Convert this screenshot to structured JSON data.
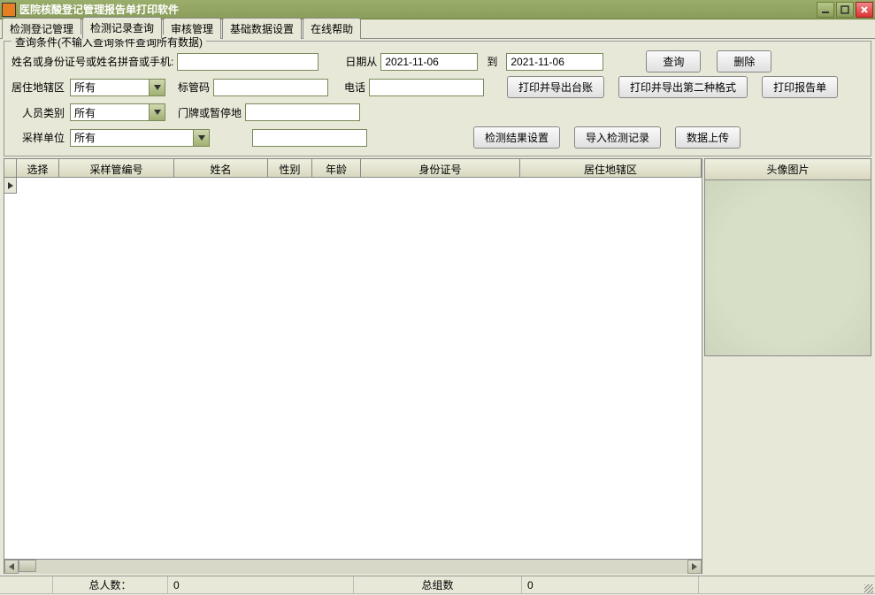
{
  "window": {
    "title": "医院核酸登记管理报告单打印软件"
  },
  "tabs": [
    "检测登记管理",
    "检测记录查询",
    "审核管理",
    "基础数据设置",
    "在线帮助"
  ],
  "activeTabIndex": 1,
  "filter": {
    "legend": "查询条件(不输入查询条件查询所有数据)",
    "name_label": "姓名或身份证号或姓名拼音或手机:",
    "name_value": "",
    "date_from_label": "日期从",
    "date_from_value": "2021-11-06",
    "date_to_label": "到",
    "date_to_value": "2021-11-06",
    "query_btn": "查询",
    "delete_btn": "删除",
    "district_label": "居住地辖区",
    "district_value": "所有",
    "barcode_label": "标管码",
    "barcode_value": "",
    "phone_label": "电话",
    "phone_value": "",
    "print_ledger_btn": "打印并导出台账",
    "print_format2_btn": "打印并导出第二种格式",
    "print_report_btn": "打印报告单",
    "person_type_label": "人员类别",
    "person_type_value": "所有",
    "address_label": "门牌或暂停地",
    "address_value": "",
    "sampling_unit_label": "采样单位",
    "sampling_unit_value": "所有",
    "extra_value": "",
    "result_setting_btn": "检测结果设置",
    "import_record_btn": "导入检测记录",
    "upload_data_btn": "数据上传"
  },
  "table": {
    "columns": [
      "选择",
      "采样管编号",
      "姓名",
      "性别",
      "年龄",
      "身份证号",
      "居住地辖区"
    ]
  },
  "right_panel": {
    "header": "头像图片"
  },
  "status": {
    "total_people_label": "总人数：",
    "total_people_value": "0",
    "total_groups_label": "总组数",
    "total_groups_value": "0"
  }
}
